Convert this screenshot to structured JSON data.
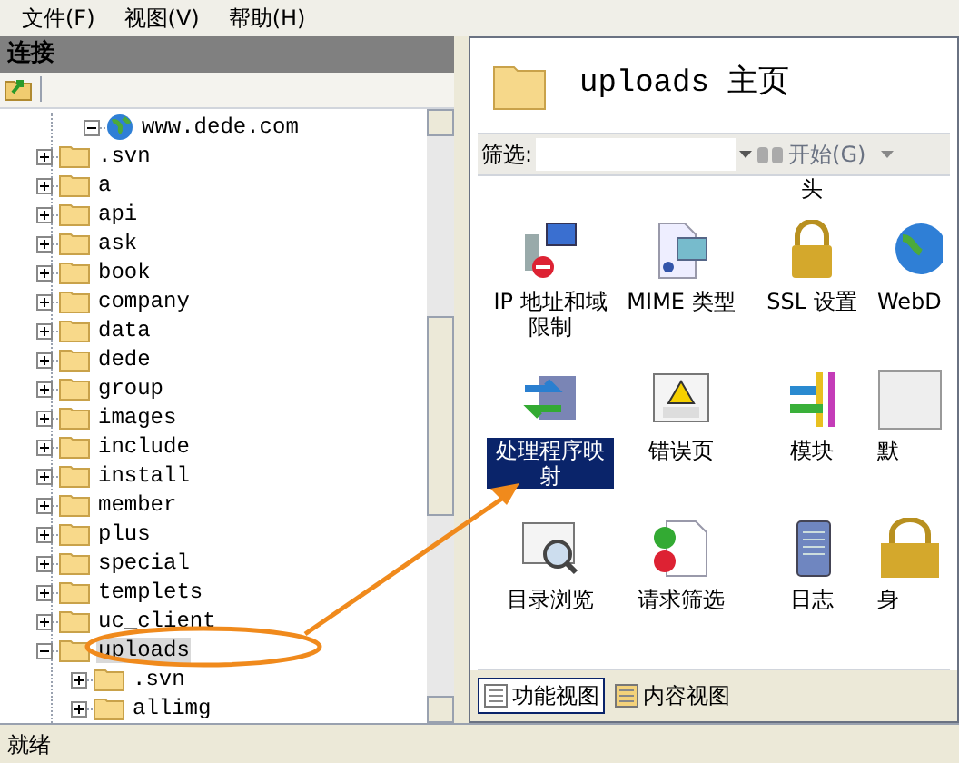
{
  "menu": [
    "文件(F)",
    "视图(V)",
    "帮助(H)"
  ],
  "connections": {
    "title": "连接",
    "tree": {
      "label": "www.dede.com",
      "expanded": true,
      "selected": false,
      "children": [
        {
          "label": ".svn",
          "expanded": false,
          "selected": false
        },
        {
          "label": "a",
          "expanded": false,
          "selected": false
        },
        {
          "label": "api",
          "expanded": false,
          "selected": false
        },
        {
          "label": "ask",
          "expanded": false,
          "selected": false
        },
        {
          "label": "book",
          "expanded": false,
          "selected": false
        },
        {
          "label": "company",
          "expanded": false,
          "selected": false
        },
        {
          "label": "data",
          "expanded": false,
          "selected": false
        },
        {
          "label": "dede",
          "expanded": false,
          "selected": false
        },
        {
          "label": "group",
          "expanded": false,
          "selected": false
        },
        {
          "label": "images",
          "expanded": false,
          "selected": false
        },
        {
          "label": "include",
          "expanded": false,
          "selected": false
        },
        {
          "label": "install",
          "expanded": false,
          "selected": false
        },
        {
          "label": "member",
          "expanded": false,
          "selected": false
        },
        {
          "label": "plus",
          "expanded": false,
          "selected": false
        },
        {
          "label": "special",
          "expanded": false,
          "selected": false
        },
        {
          "label": "templets",
          "expanded": false,
          "selected": false
        },
        {
          "label": "uc_client",
          "expanded": false,
          "selected": false
        },
        {
          "label": "uploads",
          "expanded": true,
          "selected": true,
          "children": [
            {
              "label": ".svn",
              "expanded": false,
              "selected": false
            },
            {
              "label": "allimg",
              "expanded": false,
              "selected": false
            }
          ]
        }
      ]
    }
  },
  "page": {
    "title": "uploads 主页",
    "filter": {
      "label": "筛选:",
      "go": "开始(G)"
    },
    "cut_row": {
      "label": "头"
    },
    "features": [
      {
        "label": "IP 地址和域限制",
        "selected": false
      },
      {
        "label": "MIME 类型",
        "selected": false
      },
      {
        "label": "SSL 设置",
        "selected": false
      },
      {
        "label": "WebD",
        "selected": false
      },
      {
        "label": "处理程序映射",
        "selected": true
      },
      {
        "label": "错误页",
        "selected": false
      },
      {
        "label": "模块",
        "selected": false
      },
      {
        "label": "默",
        "selected": false
      },
      {
        "label": "目录浏览",
        "selected": false
      },
      {
        "label": "请求筛选",
        "selected": false
      },
      {
        "label": "日志",
        "selected": false
      },
      {
        "label": "身",
        "selected": false
      }
    ],
    "views": [
      {
        "label": "功能视图",
        "selected": true
      },
      {
        "label": "内容视图",
        "selected": false
      }
    ]
  },
  "status_bar": "就绪"
}
